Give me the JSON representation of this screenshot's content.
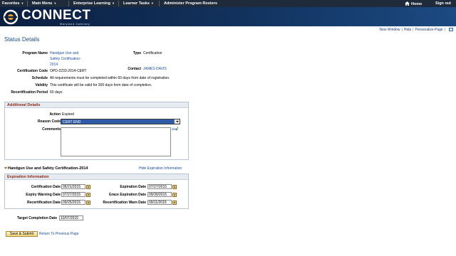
{
  "nav": {
    "menus": [
      "Favorites",
      "Main Menu",
      "Enterprise Learning",
      "Learner Tasks",
      "Administer Program Rosters"
    ],
    "home": "Home",
    "sign_out": "Sign out"
  },
  "brand": {
    "name": "CONNECT",
    "subtitle": "Maryland Judiciary"
  },
  "utility": {
    "new_window": "New Window",
    "help": "Help",
    "personalize": "Personalize Page",
    "sep": "|"
  },
  "page_title": "Status Details",
  "details": {
    "program_name_label": "Program Name",
    "program_name": [
      "Handgun Use and",
      "Safety Certification-",
      "2014"
    ],
    "type_label": "Type",
    "type": "Certification",
    "cert_code_label": "Certification Code",
    "cert_code": "OPD-2233-2014-CERT",
    "contact_label": "Contact",
    "contact": "JAMES DAVIS",
    "schedule_label": "Schedule",
    "schedule": "All requirements must be completed within 60 days from date of registration.",
    "validity_label": "Validity",
    "validity": "This certificate will be valid for 300 days from date of completion.",
    "recert_period_label": "Recertification Period",
    "recert_period": "60 days"
  },
  "additional": {
    "title": "Additional Details",
    "action_label": "Action",
    "action": "Expired",
    "reason_label": "Reason Code",
    "reason": "CERT END",
    "comments_label": "Comments"
  },
  "collapse": {
    "title": "Handgun Use and Safety Certification-2014",
    "hide_link": "Hide Expiration Information"
  },
  "expiration": {
    "title": "Expiration Information",
    "cert_date_label": "Certification Date",
    "cert_date": "06/21/2015",
    "exp_date_label": "Expiration Date",
    "exp_date": "07/27/2015",
    "exp_warn_label": "Expiry Warning Date",
    "exp_warn": "07/27/2015",
    "grace_label": "Grace Expiration Date",
    "grace": "09/30/2015",
    "recert_date_label": "Recertification Date",
    "recert_date": "09/25/2015",
    "recert_warn_label": "Recertification Warn Date",
    "recert_warn": "09/11/2015"
  },
  "target": {
    "label": "Target Completion Date",
    "value": "10/07/2015"
  },
  "actions": {
    "save_submit": "Save & Submit",
    "return": "Return To Previous Page"
  },
  "colors": {
    "nav_bg": "#1f2a3a",
    "banner": "#12335f",
    "link": "#1a4a9a",
    "section_title": "#8a2a12"
  }
}
